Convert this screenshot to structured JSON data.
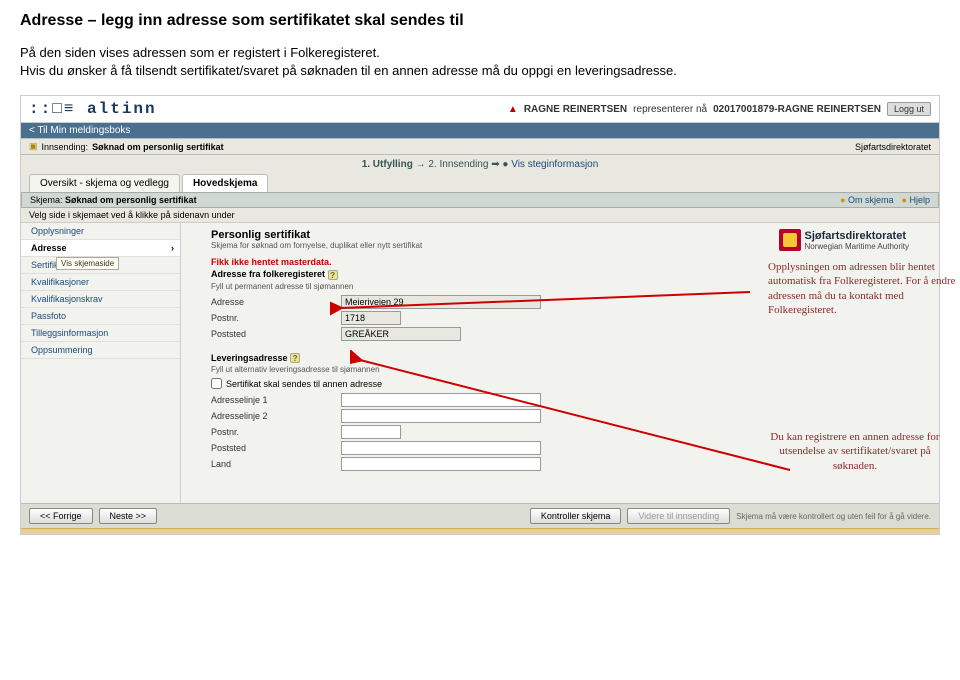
{
  "doc": {
    "title": "Adresse – legg inn adresse som sertifikatet skal sendes til",
    "para": "På den siden vises adressen som er registert i Folkeregisteret.\nHvis du ønsker å få tilsendt sertifikatet/svaret på søknaden til en annen adresse må du oppgi en leveringsadresse."
  },
  "topbar": {
    "logo": "::□≡ altinn",
    "user_prefix": "RAGNE REINERTSEN",
    "represents": "representerer nå",
    "user_id": "02017001879-RAGNE REINERTSEN",
    "logout": "Logg ut"
  },
  "mailbox": "< Til Min meldingsboks",
  "crumbs": {
    "sending": "Innsending:",
    "title": "Søknad om personlig sertifikat",
    "agency": "Sjøfartsdirektoratet"
  },
  "steps": {
    "s1": "1. Utfylling",
    "s2": "2. Innsending",
    "link": "Vis steginformasjon"
  },
  "tabs": {
    "t1": "Oversikt - skjema og vedlegg",
    "t2": "Hovedskjema"
  },
  "inner": {
    "label": "Skjema:",
    "name": "Søknad om personlig sertifikat",
    "om": "Om skjema",
    "hjelp": "Hjelp"
  },
  "sub_label": "Velg side i skjemaet ved å klikke på sidenavn under",
  "sidebar": {
    "items": [
      "Opplysninger",
      "Adresse",
      "Sertifikat",
      "Kvalifikasjoner",
      "Kvalifikasjonskrav",
      "Passfoto",
      "Tilleggsinformasjon",
      "Oppsummering"
    ],
    "tooltip": "Vis skjemaside"
  },
  "content": {
    "title": "Personlig sertifikat",
    "sub": "Skjema for søknad om fornyelse, duplikat eller nytt sertifikat",
    "agency_big": "Sjøfartsdirektoratet",
    "agency_small": "Norwegian Maritime Authority",
    "notice": "Fikk ikke hentet masterdata.",
    "folk_head": "Adresse fra folkeregisteret",
    "folk_sub": "Fyll ut permanent adresse til sjømannen",
    "fields": {
      "adresse_label": "Adresse",
      "adresse_val": "Meieriveien 29",
      "postnr_label": "Postnr.",
      "postnr_val": "1718",
      "poststed_label": "Poststed",
      "poststed_val": "GREÅKER"
    },
    "lev_head": "Leveringsadresse",
    "lev_sub": "Fyll ut alternativ leveringsadresse til sjømannen",
    "chk_label": "Sertifikat skal sendes til annen adresse",
    "lev_fields": {
      "l1": "Adresselinje 1",
      "l2": "Adresselinje 2",
      "postnr": "Postnr.",
      "poststed": "Poststed",
      "land": "Land"
    }
  },
  "footer": {
    "prev": "<< Forrige",
    "next": "Neste >>",
    "check": "Kontroller skjema",
    "forward": "Videre til innsending",
    "note": "Skjema må være kontrollert og uten feil for å gå videre."
  },
  "callouts": {
    "c1": "Opplysningen om adressen blir hentet automatisk fra Folkeregisteret. For å endre adressen må du ta kontakt med Folkeregisteret.",
    "c2": "Du kan registrere en annen adresse for utsendelse av sertifikatet/svaret på søknaden."
  }
}
